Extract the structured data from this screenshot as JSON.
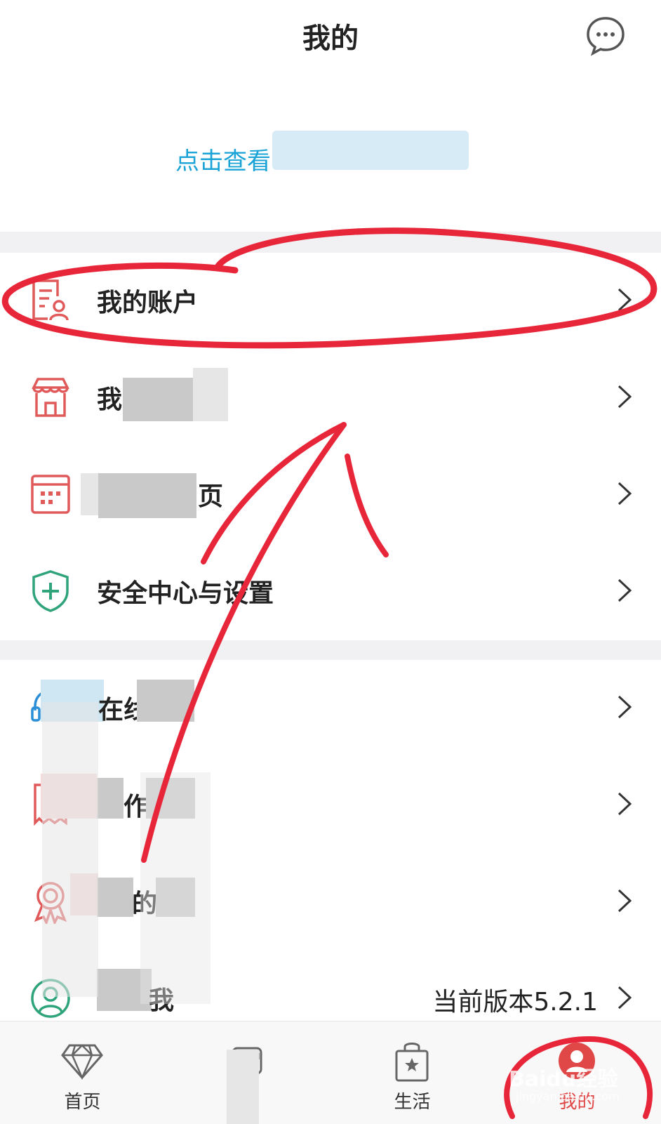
{
  "header": {
    "title": "我的",
    "message_icon": "chat-bubble-icon"
  },
  "profile": {
    "login_prompt": "点击查看"
  },
  "menu_group_1": [
    {
      "label": "我的账户",
      "icon": "account-doc-icon"
    },
    {
      "label": "我",
      "icon": "store-icon"
    },
    {
      "label": "页",
      "icon": "calendar-icon"
    },
    {
      "label": "安全中心与设置",
      "icon": "shield-plus-icon"
    }
  ],
  "menu_group_2": [
    {
      "label": "在线",
      "icon": "headset-icon"
    },
    {
      "label": "作",
      "icon": "receipt-icon"
    },
    {
      "label": "的",
      "icon": "award-icon"
    },
    {
      "label": "我",
      "icon": "user-circle-icon",
      "right_text": "当前版本5.2.1"
    }
  ],
  "tabbar": [
    {
      "label": "首页",
      "icon": "diamond-icon"
    },
    {
      "label": "",
      "icon": "trend-chart-icon"
    },
    {
      "label": "生活",
      "icon": "shopping-bag-star-icon"
    },
    {
      "label": "我的",
      "icon": "user-icon"
    }
  ],
  "watermark": {
    "text": "Baidu经验",
    "subtext": "jingyan.baidu.com"
  },
  "colors": {
    "accent": "#e04848",
    "link": "#1aa3d6",
    "green": "#2fa37a",
    "annotation": "#e8263a"
  }
}
